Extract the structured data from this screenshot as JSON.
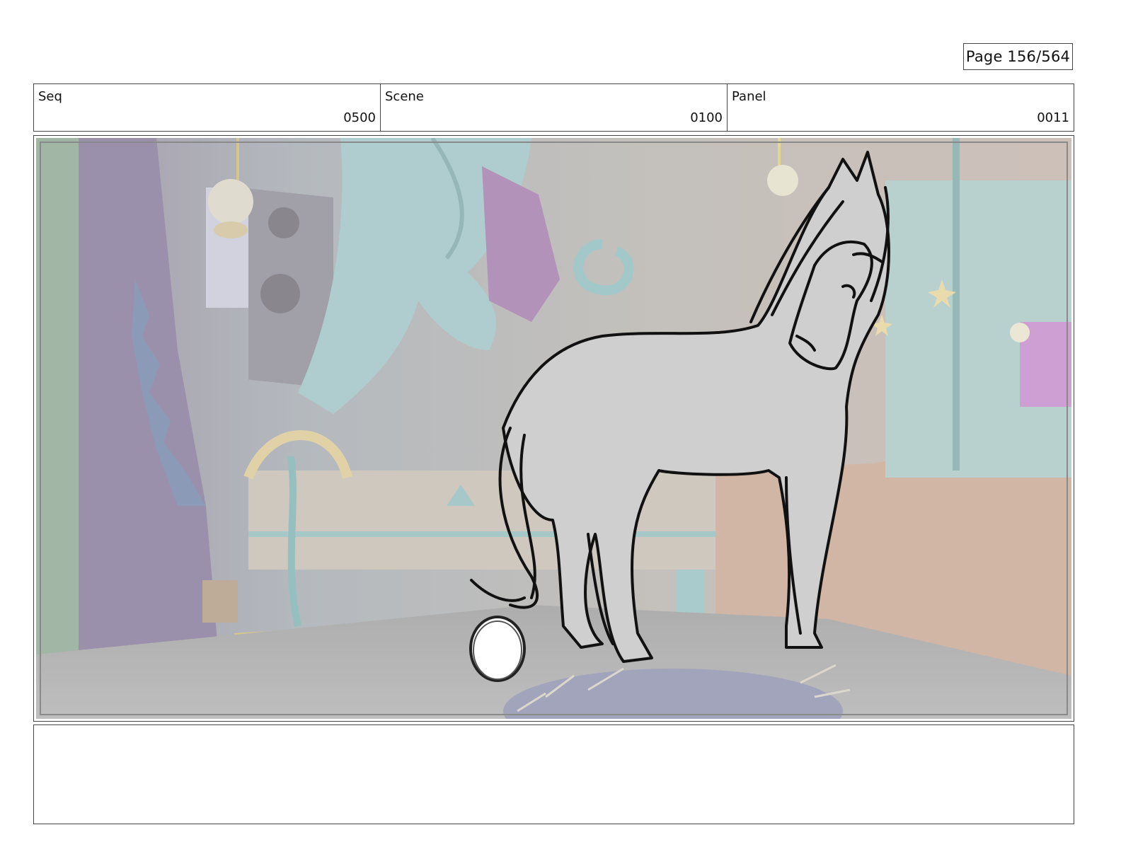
{
  "page": {
    "label": "Page 156/564"
  },
  "info_bar": {
    "cells": [
      {
        "label": "Seq",
        "value": "0500"
      },
      {
        "label": "Scene",
        "value": "0100"
      },
      {
        "label": "Panel",
        "value": "0011"
      }
    ]
  },
  "panel": {
    "subject": "horse-sketch",
    "props": [
      "egg",
      "nest",
      "unicorn-statue",
      "lamps",
      "stars"
    ]
  },
  "notes": {
    "text": ""
  },
  "colors": {
    "border": "#444444",
    "sketch_fill": "#cfcfcf",
    "floor": "#a4a4a4",
    "bg_teal": "#9cc2c0",
    "bg_purple": "#8e7a96",
    "accent_gold": "#d9c27a",
    "accent_magenta": "#b77fb9"
  }
}
